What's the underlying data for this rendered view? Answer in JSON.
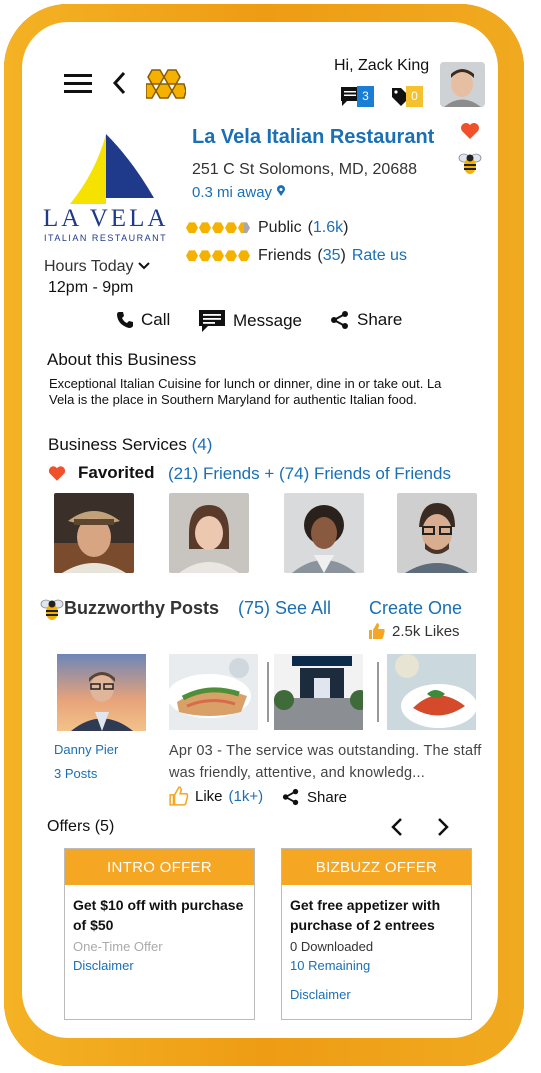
{
  "header": {
    "greeting": "Hi, Zack King",
    "messages_count": "3",
    "tags_count": "0"
  },
  "business": {
    "logo_name": "LA VELA",
    "logo_subtitle": "ITALIAN RESTAURANT",
    "name": "La Vela Italian Restaurant",
    "address": "251 C St Solomons, MD, 20688",
    "distance": "0.3 mi away",
    "hours_label": "Hours Today",
    "hours_value": "12pm - 9pm",
    "public_label": "Public",
    "public_count": "1.6k",
    "public_rating": 4.5,
    "friends_label": "Friends",
    "friends_count": "35",
    "friends_rating": 5,
    "rate_us": "Rate us"
  },
  "actions": {
    "call": "Call",
    "message": "Message",
    "share": "Share"
  },
  "about": {
    "heading": "About this Business",
    "text": "Exceptional Italian Cuisine for lunch or dinner, dine in or take out. La Vela is the place in Southern Maryland for authentic Italian food."
  },
  "services": {
    "label": "Business Services",
    "count": "(4)"
  },
  "favorited": {
    "label": "Favorited",
    "summary": "(21) Friends + (74) Friends of Friends"
  },
  "posts": {
    "heading": "Buzzworthy Posts",
    "see_all": "(75) See All",
    "create": "Create One",
    "likes": "2.5k Likes",
    "author_name": "Danny Pier",
    "author_posts": "3 Posts",
    "review": "Apr 03 - The service was outstanding. The staff was friendly, attentive, and knowledg...",
    "like_label": "Like",
    "like_count": "(1k+)",
    "share_label": "Share"
  },
  "offers": {
    "heading": "Offers (5)",
    "items": [
      {
        "type": "INTRO OFFER",
        "title": "Get $10 off with purchase of $50",
        "line1": "One-Time Offer",
        "line2": "Disclaimer"
      },
      {
        "type": "BIZBUZZ OFFER",
        "title": "Get free appetizer with purchase of 2 entrees",
        "line1": "0 Downloaded",
        "line2": "10 Remaining",
        "line3": "Disclaimer"
      }
    ]
  },
  "colors": {
    "accent_blue": "#1a6fb5",
    "honey": "#f5b100",
    "offer_orange": "#f5a623",
    "frame_orange": "#f0a018",
    "favorite_red": "#f0502a"
  }
}
